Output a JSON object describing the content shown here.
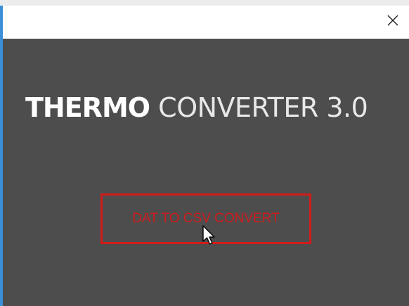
{
  "window": {
    "close_icon": "close-icon"
  },
  "app": {
    "title_bold": "THERMO",
    "title_light": "CONVERTER 3.0"
  },
  "main": {
    "convert_button_label": "DAT TO CSV CONVERT"
  },
  "colors": {
    "content_bg": "#4d4d4d",
    "accent_red": "#d11c1c",
    "title_white": "#ffffff"
  }
}
